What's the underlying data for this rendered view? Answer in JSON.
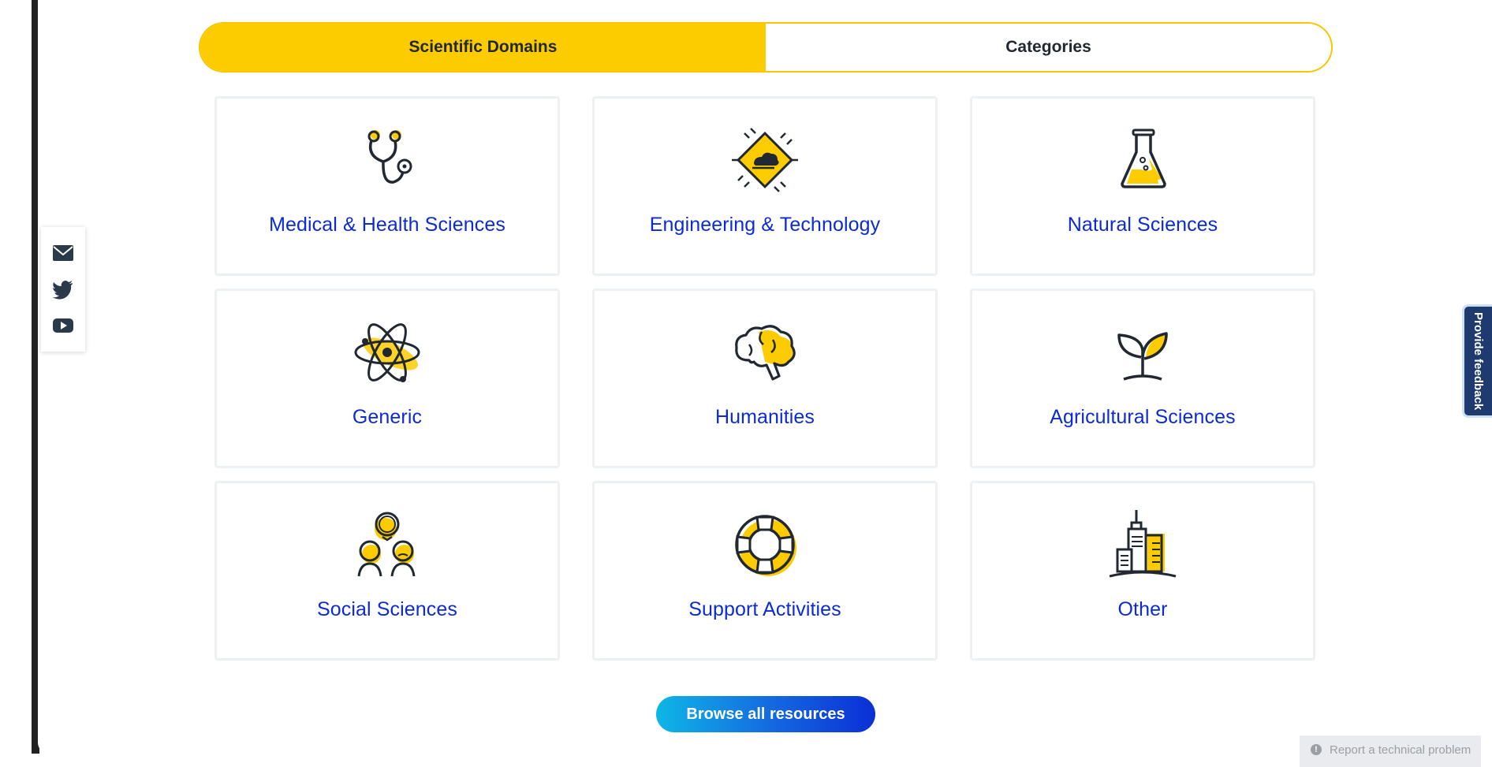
{
  "tabs": [
    {
      "label": "Scientific Domains",
      "active": true
    },
    {
      "label": "Categories",
      "active": false
    }
  ],
  "domains": [
    {
      "label": "Medical & Health Sciences",
      "icon": "stethoscope-icon"
    },
    {
      "label": "Engineering & Technology",
      "icon": "chip-icon"
    },
    {
      "label": "Natural Sciences",
      "icon": "flask-icon"
    },
    {
      "label": "Generic",
      "icon": "atom-icon"
    },
    {
      "label": "Humanities",
      "icon": "brain-icon"
    },
    {
      "label": "Agricultural Sciences",
      "icon": "sprout-icon"
    },
    {
      "label": "Social Sciences",
      "icon": "people-icon"
    },
    {
      "label": "Support Activities",
      "icon": "lifebuoy-icon"
    },
    {
      "label": "Other",
      "icon": "city-icon"
    }
  ],
  "browse_button": "Browse all resources",
  "social": [
    "email-icon",
    "twitter-icon",
    "youtube-icon"
  ],
  "feedback_label": "Provide feedback",
  "report_label": "Report a technical problem",
  "colors": {
    "accent_yellow": "#fccb00",
    "link_blue": "#0c2bd6",
    "icon_dark": "#222831",
    "feedback_bg": "#1e3a6e"
  }
}
